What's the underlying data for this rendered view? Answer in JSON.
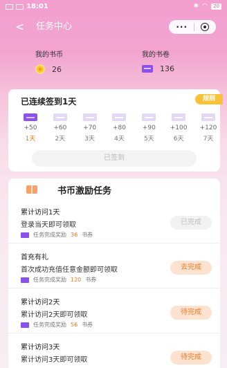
{
  "status_bar": {
    "time": "18:01",
    "battery": "20"
  },
  "nav": {
    "back_glyph": "<",
    "title": "任务中心",
    "more_glyph": "···"
  },
  "wallet": {
    "coins_label": "我的书币",
    "coins_value": "26",
    "tickets_label": "我的书卷",
    "tickets_value": "136"
  },
  "signin": {
    "title": "已连续签到1天",
    "rules_label": "规则",
    "button_label": "已签到",
    "days": [
      {
        "reward": "+50",
        "label": "1天",
        "done": true
      },
      {
        "reward": "+60",
        "label": "2天",
        "done": false
      },
      {
        "reward": "+70",
        "label": "3天",
        "done": false
      },
      {
        "reward": "+80",
        "label": "4天",
        "done": false
      },
      {
        "reward": "+90",
        "label": "5天",
        "done": false
      },
      {
        "reward": "+100",
        "label": "6天",
        "done": false
      },
      {
        "reward": "+120",
        "label": "7天",
        "done": false
      }
    ]
  },
  "tasks": {
    "title": "书币激励任务",
    "items": [
      {
        "title": "累计访问1天",
        "desc": "登录当天即可领取",
        "reward_prefix": "任务完成奖励",
        "amount": "36",
        "unit": "书券",
        "button": "已完成"
      },
      {
        "title": "首充有礼",
        "desc": "首次成功充值任意金额即可领取",
        "reward_prefix": "任务完成奖励",
        "amount": "120",
        "unit": "书券",
        "button": "去完成"
      },
      {
        "title": "累计访问2天",
        "desc": "累计访问2天即可领取",
        "reward_prefix": "任务完成奖励",
        "amount": "56",
        "unit": "书券",
        "button": "待完成"
      },
      {
        "title": "累计访问3天",
        "desc": "累计访问3天即可领取",
        "button": "待完成"
      }
    ]
  }
}
